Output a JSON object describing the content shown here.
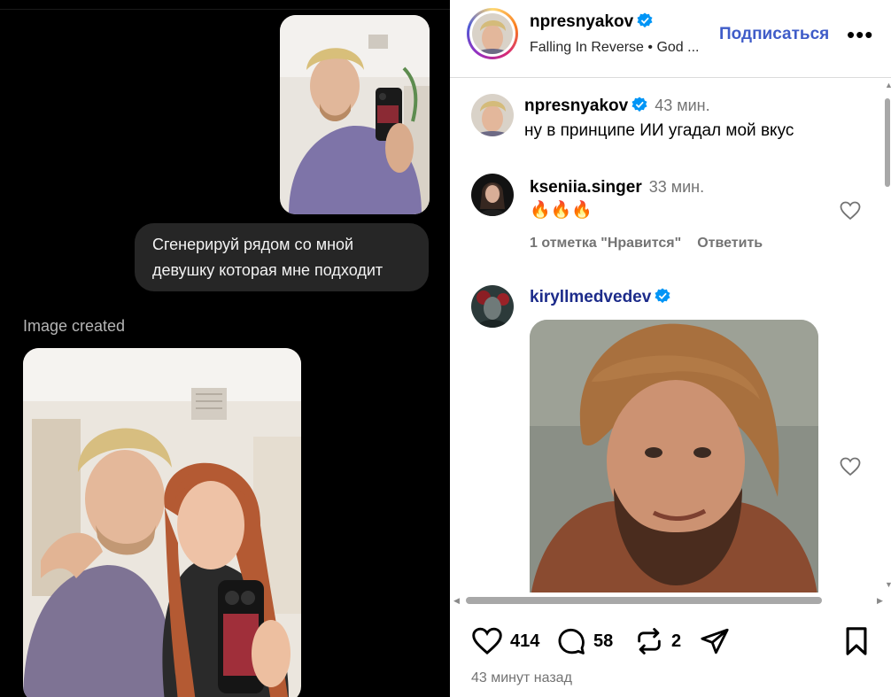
{
  "chat": {
    "user_message": "Сгенерируй рядом со мной девушку которая мне подходит",
    "image_created_label": "Image created"
  },
  "post": {
    "header": {
      "username": "npresnyakov",
      "subtitle": "Falling In Reverse • God ...",
      "follow_label": "Подписаться",
      "more_label": "•••"
    },
    "comments": [
      {
        "username": "npresnyakov",
        "time": "43 мин.",
        "text": "ну в принципе ИИ угадал мой вкус",
        "verified": true
      },
      {
        "username": "kseniia.singer",
        "time": "33 мин.",
        "text": "🔥🔥🔥",
        "likes_label": "1 отметка \"Нравится\"",
        "reply_label": "Ответить"
      },
      {
        "username": "kiryllmedvedev",
        "verified": true,
        "attachment": "bearded-man-gif"
      }
    ],
    "actions": {
      "likes": "414",
      "comments": "58",
      "reposts": "2"
    },
    "time_ago": "43 минут назад"
  },
  "colors": {
    "follow": "#3f5cc8",
    "verified": "#0095f6",
    "chat_bg": "#000000",
    "bubble_bg": "#262626"
  }
}
